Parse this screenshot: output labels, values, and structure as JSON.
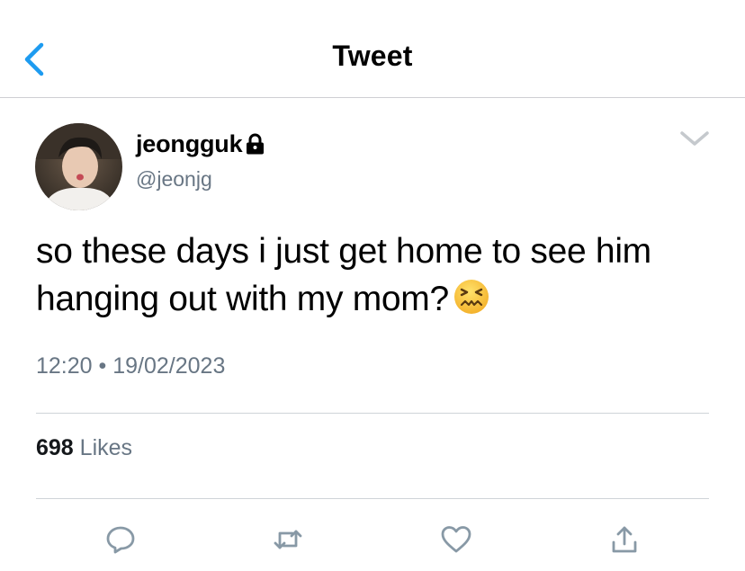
{
  "header": {
    "title": "Tweet",
    "back_icon": "chevron-left-icon",
    "accent_color": "#1d9bf0"
  },
  "tweet": {
    "display_name": "jeongguk",
    "handle": "@jeonjg",
    "protected_icon": "lock-icon",
    "text_line1": "so these days i just get home to see him",
    "text_line2": "hanging out with my mom?",
    "emoji": "confounded-face-emoji",
    "time": "12:20",
    "separator": "•",
    "date": "19/02/2023",
    "like_count": "698",
    "likes_label": "Likes"
  },
  "actions": {
    "icons": [
      "reply-icon",
      "retweet-icon",
      "like-icon",
      "share-icon"
    ]
  },
  "colors": {
    "text_primary": "#000000",
    "text_secondary": "#687684",
    "icon": "#8899a6",
    "divider": "#cfd4d8"
  }
}
